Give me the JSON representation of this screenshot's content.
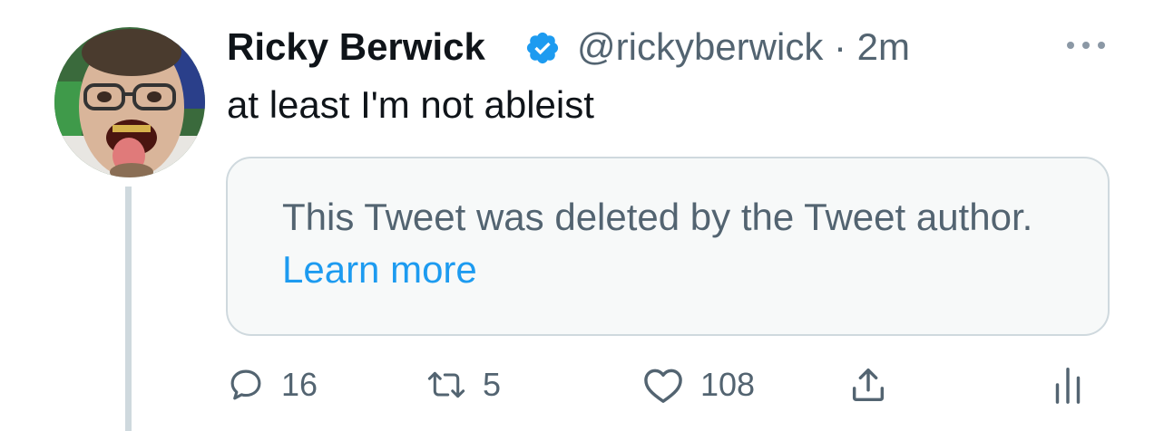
{
  "tweet": {
    "author_name": "Ricky Berwick",
    "handle": "@rickyberwick",
    "separator": "·",
    "time": "2m",
    "text": "at least I'm not ableist",
    "verified": true
  },
  "quoted": {
    "message": "This Tweet was deleted by the Tweet author.",
    "link_text": "Learn more"
  },
  "actions": {
    "reply_count": "16",
    "retweet_count": "5",
    "like_count": "108"
  },
  "colors": {
    "accent": "#1d9bf0",
    "secondary_text": "#536471",
    "primary_text": "#0f1419",
    "border": "#cfd9de",
    "card_bg": "#f7f9f9"
  }
}
